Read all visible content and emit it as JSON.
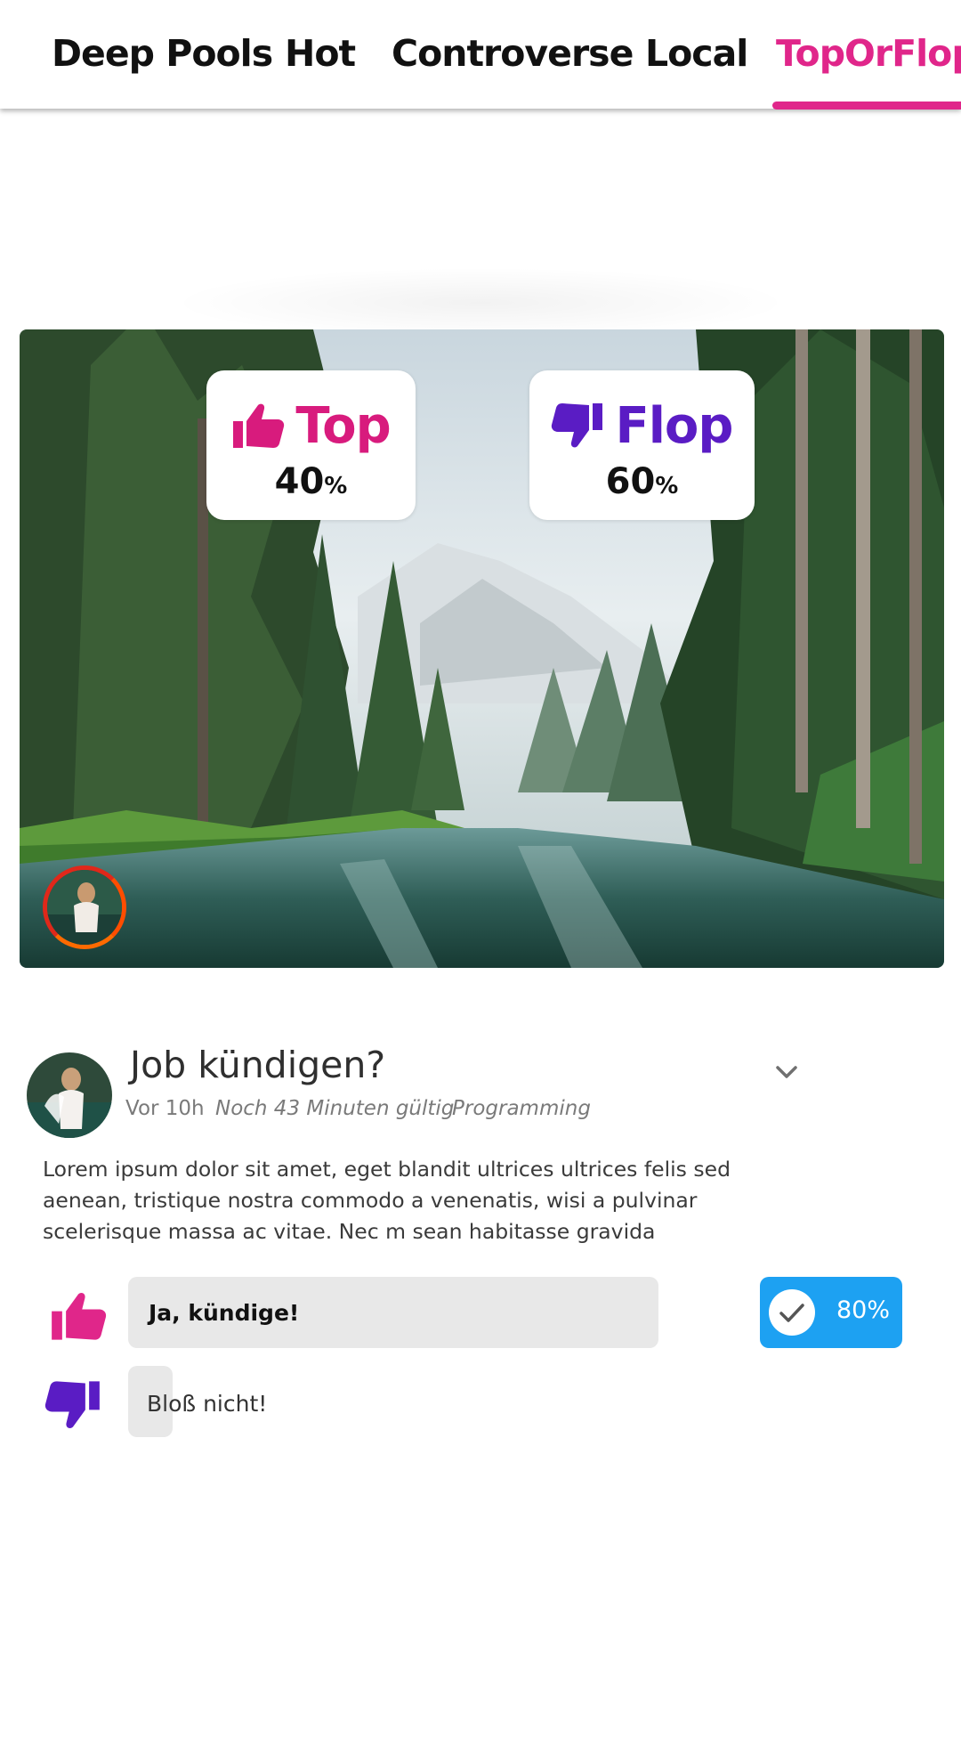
{
  "nav": {
    "tabs": [
      "Deep Pools",
      "Hot",
      "Controverse",
      "Local",
      "TopOrFlop"
    ],
    "active_tab": "TopOrFlop",
    "accent_color": "#e0268a"
  },
  "poll": {
    "top": {
      "label": "Top",
      "percent": "40",
      "unit": "%",
      "icon": "thumbs-up-icon",
      "color": "#d81b7d"
    },
    "flop": {
      "label": "Flop",
      "percent": "60",
      "unit": "%",
      "icon": "thumbs-down-icon",
      "color": "#5a1cc4"
    },
    "image_subject": "forest-lake-mountain-photo"
  },
  "post": {
    "title": "Job kündigen?",
    "time": "Vor 10h",
    "validity": "Noch 43 Minuten gültig",
    "category": "Programming",
    "body": "Lorem ipsum dolor sit amet, eget blandit ultrices ultrices felis sed aenean, tristique nostra commodo a venenatis, wisi a pulvinar scelerisque massa ac vitae. Nec m sean habitasse gravida",
    "answers": [
      {
        "label": "Ja, kündige!",
        "icon": "thumbs-up-icon",
        "selected": true,
        "fill": 0.8
      },
      {
        "label": "Bloß nicht!",
        "icon": "thumbs-down-icon",
        "selected": false,
        "fill": 0.08
      }
    ],
    "result": {
      "percent": "80%",
      "color": "#1da1f2"
    }
  }
}
